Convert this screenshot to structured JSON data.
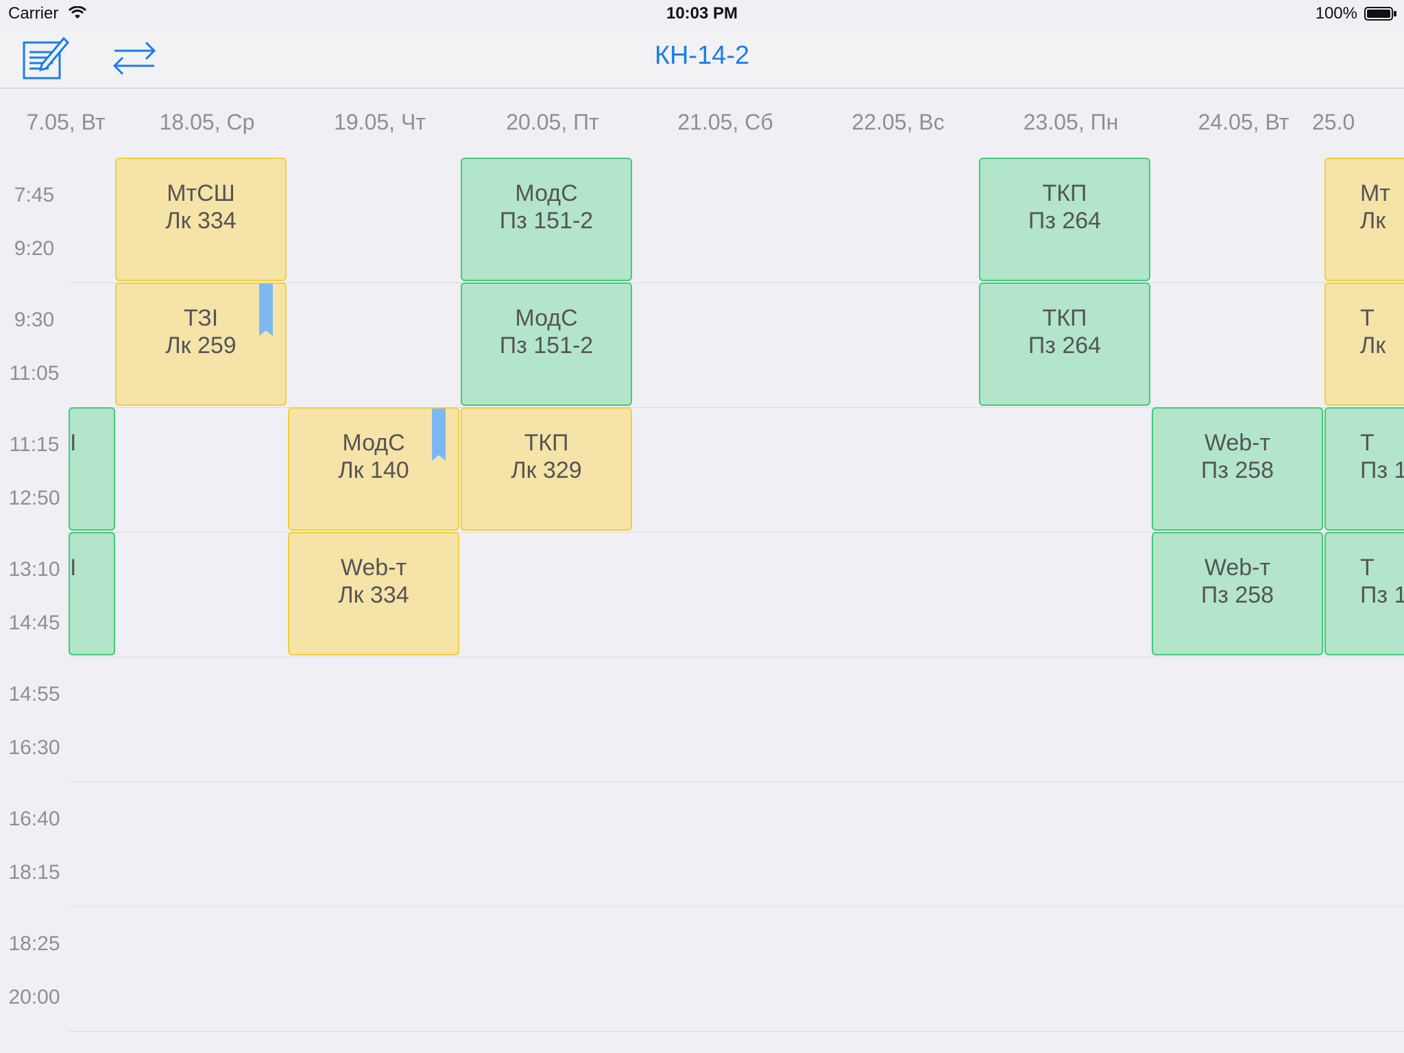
{
  "status_bar": {
    "carrier": "Carrier",
    "time": "10:03 PM",
    "battery": "100%"
  },
  "nav": {
    "title": "КН-14-2",
    "edit_icon": "note-edit-icon",
    "switch_icon": "swap-arrows-icon",
    "title_color": "#1a7ee6"
  },
  "days": [
    "7.05, Вт",
    "18.05, Ср",
    "19.05, Чт",
    "20.05, Пт",
    "21.05, Сб",
    "22.05, Вс",
    "23.05, Пн",
    "24.05, Вт",
    "25.0"
  ],
  "time_slots": [
    {
      "start": "7:45",
      "end": "9:20"
    },
    {
      "start": "9:30",
      "end": "11:05"
    },
    {
      "start": "11:15",
      "end": "12:50"
    },
    {
      "start": "13:10",
      "end": "14:45"
    },
    {
      "start": "14:55",
      "end": "16:30"
    },
    {
      "start": "16:40",
      "end": "18:15"
    },
    {
      "start": "18:25",
      "end": "20:00"
    }
  ],
  "colors": {
    "lecture_fill": "#f5e3a8",
    "lecture_border": "#f2cf3a",
    "practice_fill": "#b3e5cb",
    "practice_border": "#43c97a",
    "bookmark": "#7db8f2"
  },
  "lessons": [
    {
      "day": 0,
      "slot": 2,
      "type": "practice",
      "subject": "",
      "room": "I"
    },
    {
      "day": 0,
      "slot": 3,
      "type": "practice",
      "subject": "",
      "room": "I"
    },
    {
      "day": 1,
      "slot": 0,
      "type": "lecture",
      "subject": "МтСШ",
      "room": "Лк 334"
    },
    {
      "day": 1,
      "slot": 1,
      "type": "lecture",
      "subject": "ТЗІ",
      "room": "Лк 259",
      "bookmark": true
    },
    {
      "day": 2,
      "slot": 2,
      "type": "lecture",
      "subject": "МодС",
      "room": "Лк 140",
      "bookmark": true
    },
    {
      "day": 2,
      "slot": 3,
      "type": "lecture",
      "subject": "Web-т",
      "room": "Лк 334"
    },
    {
      "day": 3,
      "slot": 0,
      "type": "practice",
      "subject": "МодС",
      "room": "Пз 151-2"
    },
    {
      "day": 3,
      "slot": 1,
      "type": "practice",
      "subject": "МодС",
      "room": "Пз 151-2"
    },
    {
      "day": 3,
      "slot": 2,
      "type": "lecture",
      "subject": "ТКП",
      "room": "Лк 329"
    },
    {
      "day": 6,
      "slot": 0,
      "type": "practice",
      "subject": "ТКП",
      "room": "Пз 264"
    },
    {
      "day": 6,
      "slot": 1,
      "type": "practice",
      "subject": "ТКП",
      "room": "Пз 264"
    },
    {
      "day": 7,
      "slot": 2,
      "type": "practice",
      "subject": "Web-т",
      "room": "Пз 258"
    },
    {
      "day": 7,
      "slot": 3,
      "type": "practice",
      "subject": "Web-т",
      "room": "Пз 258"
    },
    {
      "day": 8,
      "slot": 0,
      "type": "lecture",
      "subject": "Мт",
      "room": "Лк"
    },
    {
      "day": 8,
      "slot": 1,
      "type": "lecture",
      "subject": "Т",
      "room": "Лк"
    },
    {
      "day": 8,
      "slot": 2,
      "type": "practice",
      "subject": "Т",
      "room": "Пз 1"
    },
    {
      "day": 8,
      "slot": 3,
      "type": "practice",
      "subject": "Т",
      "room": "Пз 1"
    }
  ]
}
